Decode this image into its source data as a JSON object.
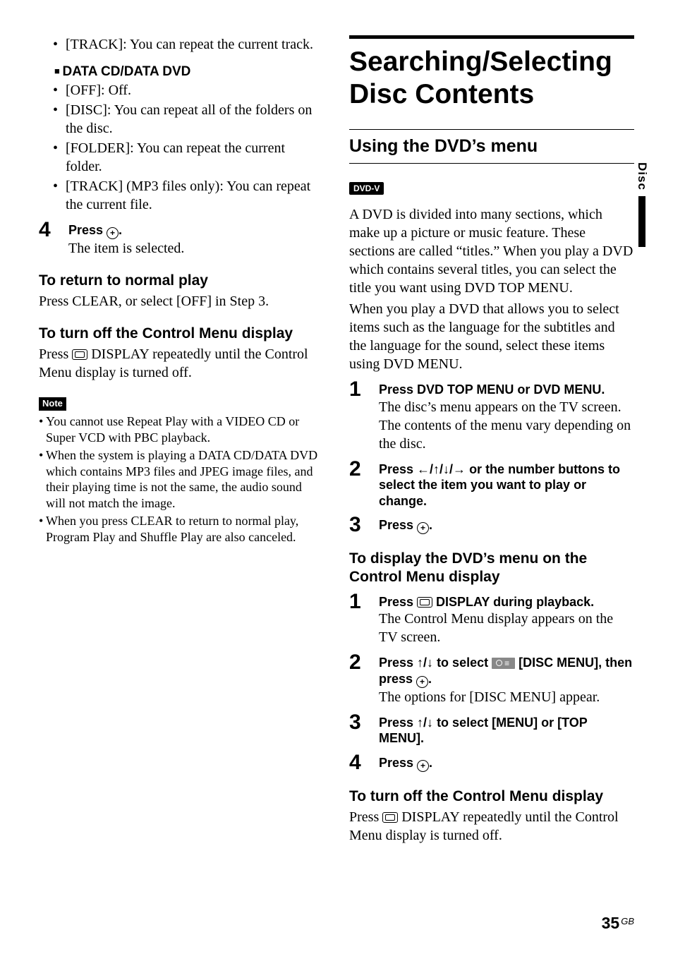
{
  "left": {
    "bullets_top": [
      "[TRACK]: You can repeat the current track."
    ],
    "subhead_prefix": "■ ",
    "subhead": "DATA CD/DATA DVD",
    "bullets_data": [
      "[OFF]: Off.",
      "[DISC]: You can repeat all of the folders on the disc.",
      "[FOLDER]: You can repeat the current folder.",
      "[TRACK] (MP3 files only): You can repeat the current file."
    ],
    "step4_num": "4",
    "step4_lead_a": "Press ",
    "step4_lead_b": ".",
    "step4_body": "The item is selected.",
    "h_normal": "To return to normal play",
    "p_normal": "Press CLEAR, or select [OFF] in Step 3.",
    "h_off": "To turn off the Control Menu display",
    "p_off_a": "Press ",
    "p_off_b": " DISPLAY repeatedly until the Control Menu display is turned off.",
    "note_label": "Note",
    "notes": [
      "You cannot use Repeat Play with a VIDEO CD or Super VCD with PBC playback.",
      "When the system is playing a DATA CD/DATA DVD which contains MP3 files and JPEG image files, and their playing time is not the same, the audio sound will not match the image.",
      "When you press CLEAR to return to normal play, Program Play and Shuffle Play are also canceled."
    ]
  },
  "right": {
    "title": "Searching/Selecting Disc Contents",
    "subtitle": "Using the DVD’s menu",
    "tag": "DVD-V",
    "intro_a": "A DVD is divided into many sections, which make up a picture or music feature. These sections are called “titles.” When you play a DVD which contains several titles, you can select the title you want using DVD TOP MENU.",
    "intro_b": "When you play a DVD that allows you to select items such as the language for the subtitles and the language for the sound, select these items using DVD MENU.",
    "steps_a": {
      "s1_num": "1",
      "s1_lead": "Press DVD TOP MENU or DVD MENU.",
      "s1_body": "The disc’s menu appears on the TV screen. The contents of the menu vary depending on the disc.",
      "s2_num": "2",
      "s2_lead_a": "Press ",
      "s2_lead_arrows": "←/↑/↓/→",
      "s2_lead_b": " or the number buttons to select the item you want to play or change.",
      "s3_num": "3",
      "s3_lead_a": "Press ",
      "s3_lead_b": "."
    },
    "h_disp": "To display the DVD’s menu on the Control Menu display",
    "steps_b": {
      "s1_num": "1",
      "s1_lead_a": "Press ",
      "s1_lead_b": " DISPLAY during playback.",
      "s1_body": "The Control Menu display appears on the TV screen.",
      "s2_num": "2",
      "s2_lead_a": "Press ",
      "s2_lead_ar1": "↑/↓",
      "s2_lead_b": " to select ",
      "s2_lead_c": " [DISC MENU], then press ",
      "s2_lead_d": ".",
      "s2_body": "The options for [DISC MENU] appear.",
      "s3_num": "3",
      "s3_lead_a": "Press ",
      "s3_lead_ar": "↑/↓",
      "s3_lead_b": " to select [MENU] or [TOP MENU].",
      "s4_num": "4",
      "s4_lead_a": "Press ",
      "s4_lead_b": "."
    },
    "h_off2": "To turn off the Control Menu display",
    "p_off2_a": "Press ",
    "p_off2_b": " DISPLAY repeatedly until the Control Menu display is turned off."
  },
  "side_tab": "Disc",
  "page_num": "35",
  "page_lang": "GB"
}
